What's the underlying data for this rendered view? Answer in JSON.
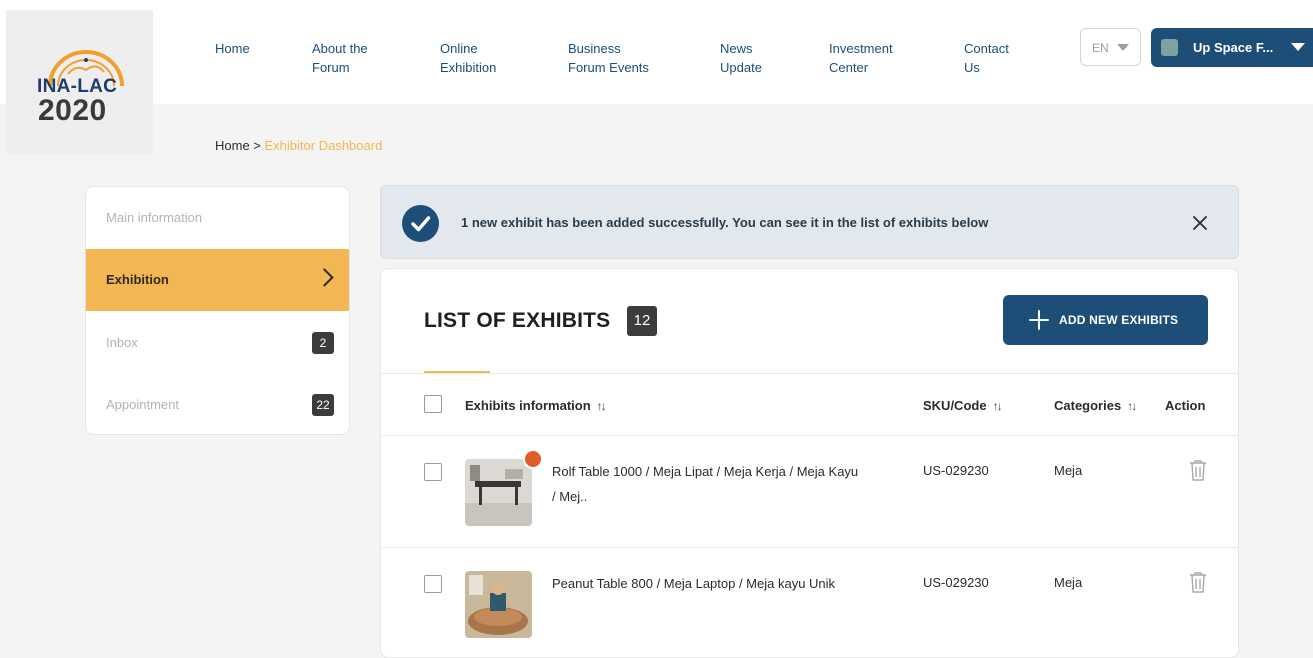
{
  "brand": {
    "logo_text": "INA-LAC",
    "logo_year": "2020"
  },
  "nav": [
    {
      "label": "Home"
    },
    {
      "label": "About the\nForum"
    },
    {
      "label": "Online\nExhibition"
    },
    {
      "label": "Business\nForum Events"
    },
    {
      "label": "News\nUpdate"
    },
    {
      "label": "Investment\nCenter"
    },
    {
      "label": "Contact\nUs"
    }
  ],
  "language": {
    "selected": "EN"
  },
  "user": {
    "name": "Up Space F..."
  },
  "breadcrumb": {
    "home": "Home",
    "separator": " > ",
    "current": "Exhibitor Dashboard"
  },
  "sidebar": {
    "items": [
      {
        "label": "Main information"
      },
      {
        "label": "Exhibition"
      },
      {
        "label": "Inbox",
        "badge": "2"
      },
      {
        "label": "Appointment",
        "badge": "22"
      }
    ]
  },
  "alert": {
    "message": "1 new exhibit has been added successfully. You can see it in the list of exhibits below"
  },
  "list": {
    "title": "LIST OF EXHIBITS",
    "count": "12",
    "add_button": "ADD NEW EXHIBITS",
    "columns": {
      "info": "Exhibits information",
      "sku": "SKU/Code",
      "categories": "Categories",
      "action": "Action"
    },
    "sort_glyph": "↑↓",
    "rows": [
      {
        "name": "Rolf Table 1000 / Meja Lipat / Meja Kerja / Meja Kayu / Mej..",
        "sku": "US-029230",
        "category": "Meja"
      },
      {
        "name": "Peanut Table 800 / Meja Laptop / Meja kayu Unik",
        "sku": "US-029230",
        "category": "Meja"
      }
    ]
  },
  "colors": {
    "primary": "#1d4e78",
    "accent": "#f2b752",
    "new_dot": "#e25b2a"
  }
}
